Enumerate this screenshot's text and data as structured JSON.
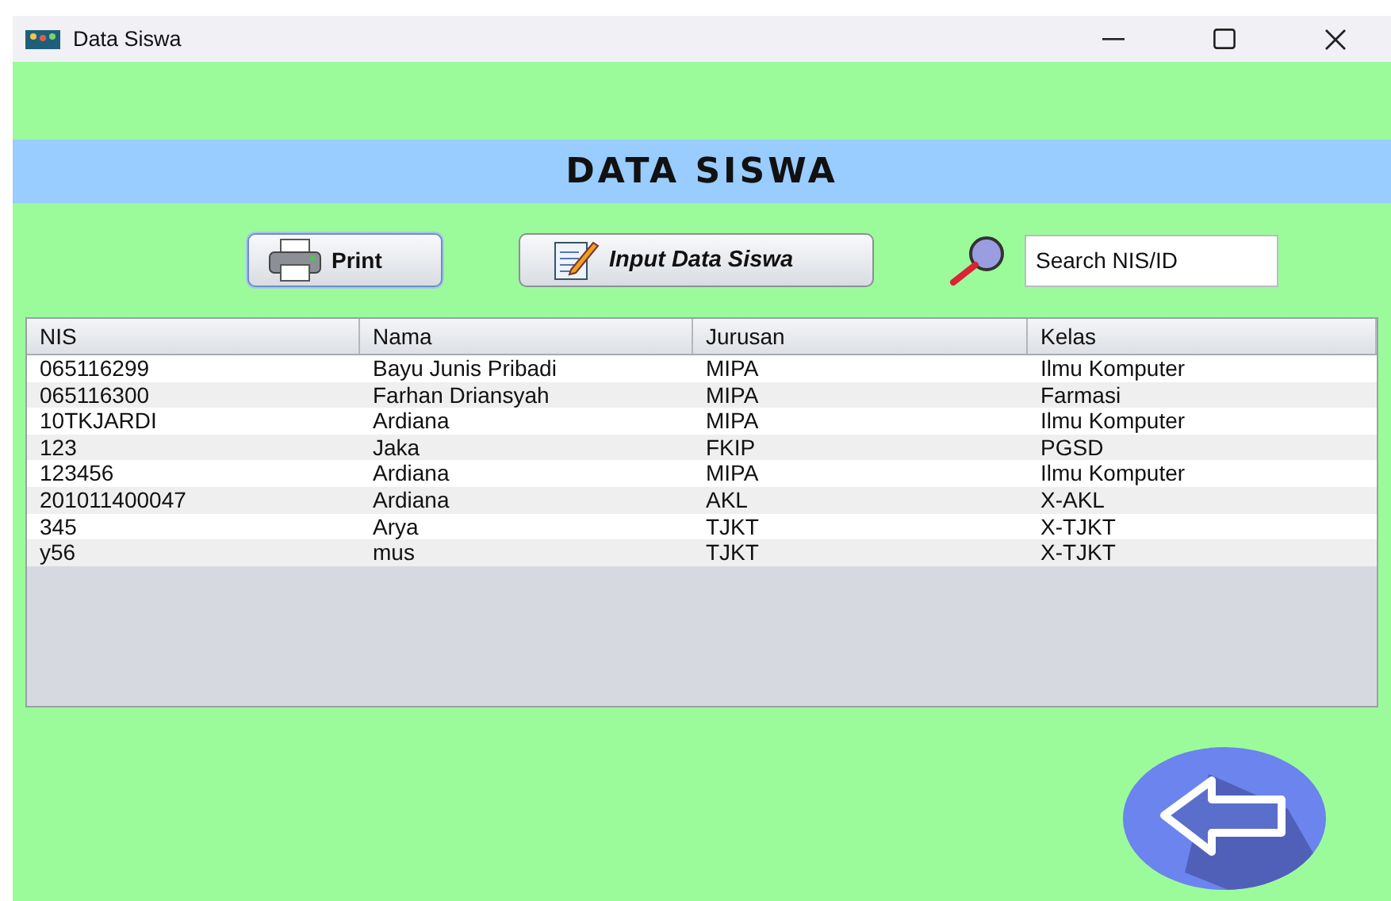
{
  "window": {
    "title": "Data Siswa"
  },
  "header": {
    "title": "DATA SISWA"
  },
  "toolbar": {
    "print_button": "Print",
    "input_button": "Input Data Siswa",
    "search": {
      "value": "Search NIS/ID"
    }
  },
  "table": {
    "columns": [
      "NIS",
      "Nama",
      "Jurusan",
      "Kelas"
    ],
    "rows": [
      [
        "065116299",
        "Bayu Junis Pribadi",
        "MIPA",
        "Ilmu Komputer"
      ],
      [
        "065116300",
        "Farhan Driansyah",
        "MIPA",
        "Farmasi"
      ],
      [
        "10TKJARDI",
        "Ardiana",
        "MIPA",
        "Ilmu Komputer"
      ],
      [
        "123",
        "Jaka",
        "FKIP",
        "PGSD"
      ],
      [
        "123456",
        "Ardiana",
        "MIPA",
        "Ilmu Komputer"
      ],
      [
        "201011400047",
        "Ardiana",
        "AKL",
        "X-AKL"
      ],
      [
        "345",
        "Arya",
        "TJKT",
        "X-TJKT"
      ],
      [
        "y56",
        "mus",
        "TJKT",
        "X-TJKT"
      ]
    ]
  }
}
